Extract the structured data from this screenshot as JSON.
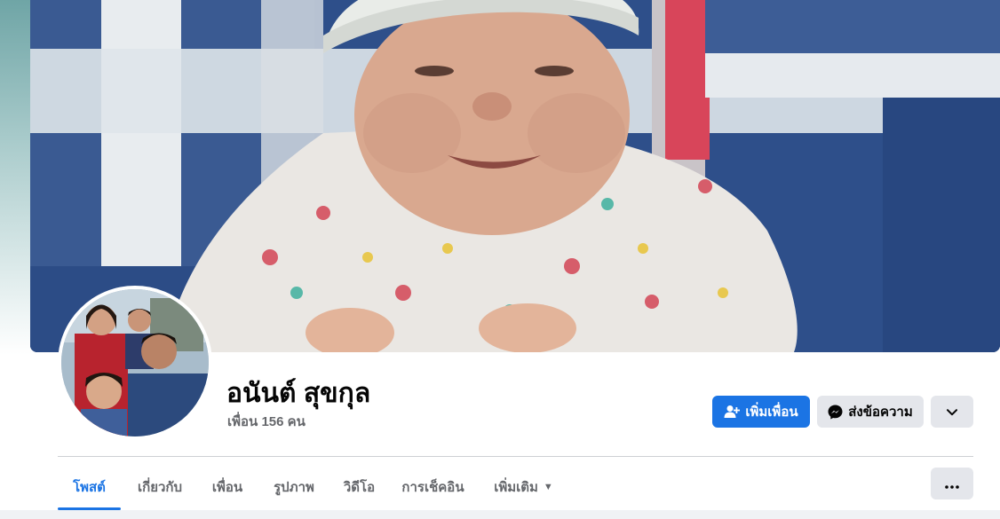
{
  "profile": {
    "name": "อนันต์ สุขกุล",
    "friends_text": "เพื่อน 156 คน"
  },
  "actions": {
    "add_friend_label": "เพิ่มเพื่อน",
    "message_label": "ส่งข้อความ",
    "add_friend_icon": "person-add-icon",
    "message_icon": "messenger-icon",
    "more_icon": "chevron-down-icon"
  },
  "tabs": [
    {
      "label": "โพสต์",
      "active": true
    },
    {
      "label": "เกี่ยวกับ",
      "active": false
    },
    {
      "label": "เพื่อน",
      "active": false
    },
    {
      "label": "รูปภาพ",
      "active": false
    },
    {
      "label": "วิดีโอ",
      "active": false
    },
    {
      "label": "การเช็คอิน",
      "active": false
    },
    {
      "label": "เพิ่มเติม",
      "active": false
    }
  ],
  "overflow_icon": "more-dots-icon",
  "colors": {
    "accent": "#1b74e4",
    "secondary_button": "#e4e6eb",
    "muted_text": "#65676b"
  }
}
